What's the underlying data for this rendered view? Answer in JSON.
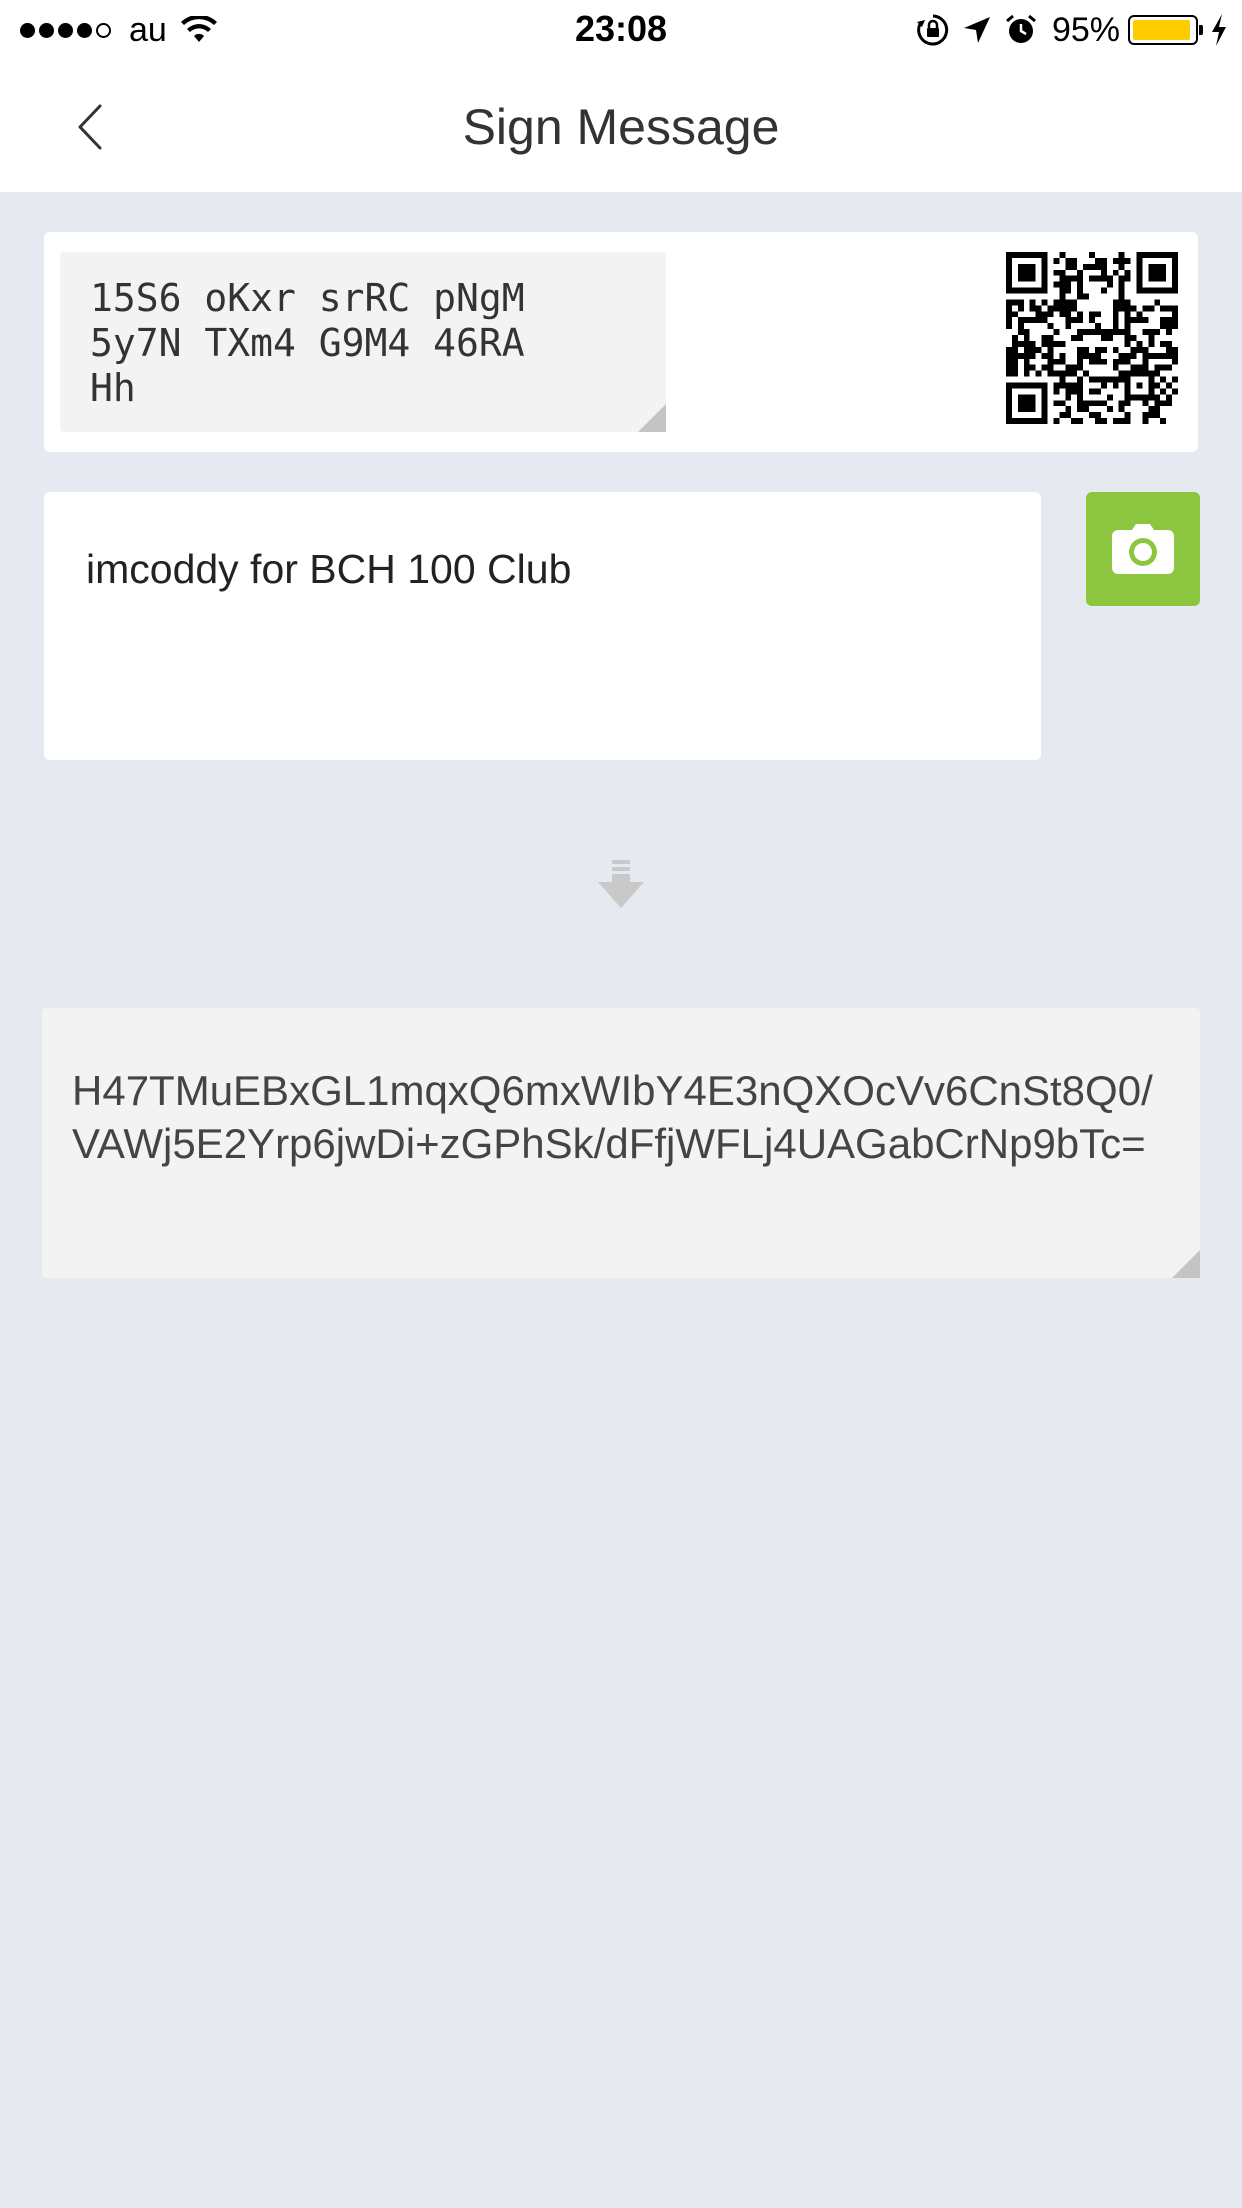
{
  "status_bar": {
    "carrier": "au",
    "time": "23:08",
    "battery_percent": "95%",
    "battery_level": 0.95,
    "signal_bars_filled": 4,
    "signal_bars_total": 5
  },
  "nav": {
    "title": "Sign Message"
  },
  "address": {
    "text": "15S6 oKxr srRC pNgM\n5y7N TXm4 G9M4 46RA\nHh"
  },
  "message": {
    "text": "imcoddy for BCH 100 Club"
  },
  "signature": {
    "text": "H47TMuEBxGL1mqxQ6mxWIbY4E3nQXOcVv6CnSt8Q0/VAWj5E2Yrp6jwDi+zGPhSk/dFfjWFLj4UAGabCrNp9bTc="
  },
  "colors": {
    "background": "#e6e9f0",
    "accent_green": "#8cc63e",
    "battery_yellow": "#ffcc00"
  },
  "icons": {
    "back": "chevron-left-icon",
    "camera": "camera-icon",
    "arrow": "arrow-down-icon",
    "qr": "qr-code-icon"
  }
}
